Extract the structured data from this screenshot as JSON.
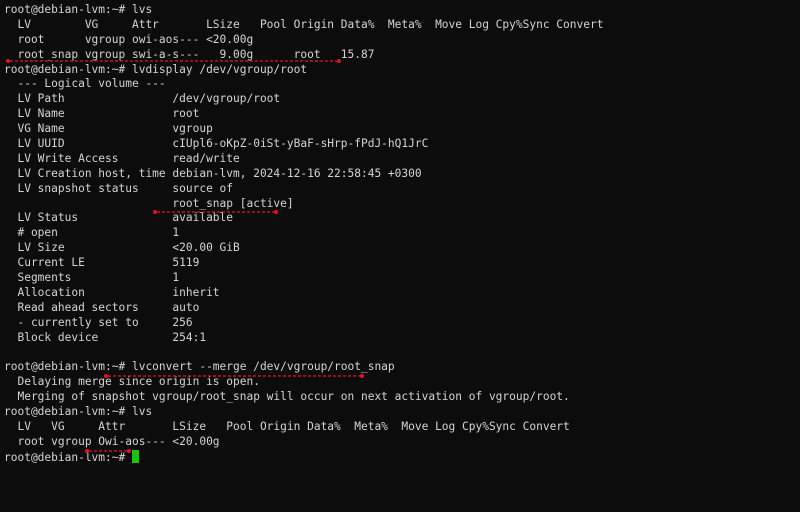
{
  "terminal": {
    "lines": [
      "root@debian-lvm:~# lvs",
      "  LV        VG     Attr       LSize   Pool Origin Data%  Meta%  Move Log Cpy%Sync Convert",
      "  root      vgroup owi-aos--- <20.00g",
      "  root_snap vgroup swi-a-s---   9.00g      root   15.87",
      "root@debian-lvm:~# lvdisplay /dev/vgroup/root",
      "  --- Logical volume ---",
      "  LV Path                /dev/vgroup/root",
      "  LV Name                root",
      "  VG Name                vgroup",
      "  LV UUID                cIUpl6-oKpZ-0iSt-yBaF-sHrp-fPdJ-hQ1JrC",
      "  LV Write Access        read/write",
      "  LV Creation host, time debian-lvm, 2024-12-16 22:58:45 +0300",
      "  LV snapshot status     source of",
      "                         root_snap [active]",
      "  LV Status              available",
      "  # open                 1",
      "  LV Size                <20.00 GiB",
      "  Current LE             5119",
      "  Segments               1",
      "  Allocation             inherit",
      "  Read ahead sectors     auto",
      "  - currently set to     256",
      "  Block device           254:1",
      "",
      "root@debian-lvm:~# lvconvert --merge /dev/vgroup/root_snap",
      "  Delaying merge since origin is open.",
      "  Merging of snapshot vgroup/root_snap will occur on next activation of vgroup/root.",
      "root@debian-lvm:~# lvs",
      "  LV   VG     Attr       LSize   Pool Origin Data%  Meta%  Move Log Cpy%Sync Convert",
      "  root vgroup Owi-aos--- <20.00g",
      "root@debian-lvm:~# "
    ]
  },
  "colors": {
    "background": "#0c0c0c",
    "text": "#d4d4d4",
    "cursor": "#16c60c",
    "annotation": "#e81123"
  }
}
